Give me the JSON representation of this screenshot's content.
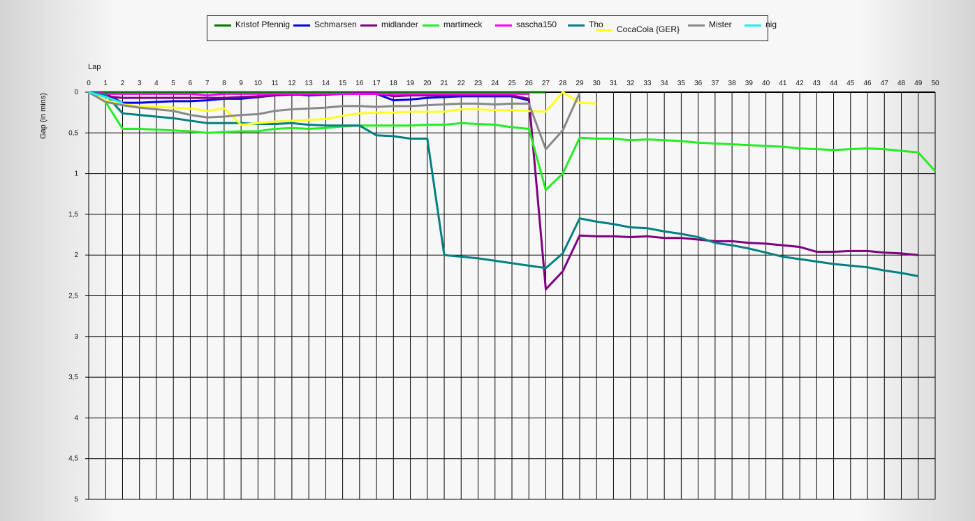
{
  "chart_data": {
    "type": "line",
    "title": "",
    "xlabel": "Lap",
    "ylabel": "Gap (in mins)",
    "xlim": [
      0,
      50
    ],
    "ylim": [
      0,
      5
    ],
    "y_inverted": true,
    "grid": true,
    "legend_position": "top",
    "x_ticks": [
      "0",
      "1",
      "2",
      "3",
      "4",
      "5",
      "6",
      "7",
      "8",
      "9",
      "10",
      "11",
      "12",
      "13",
      "14",
      "15",
      "16",
      "17",
      "18",
      "19",
      "20",
      "21",
      "22",
      "23",
      "24",
      "25",
      "26",
      "27",
      "28",
      "29",
      "30",
      "31",
      "32",
      "33",
      "34",
      "35",
      "36",
      "37",
      "38",
      "39",
      "40",
      "41",
      "42",
      "43",
      "44",
      "45",
      "46",
      "47",
      "48",
      "49",
      "50"
    ],
    "y_ticks": [
      "0",
      "0,5",
      "1",
      "1,5",
      "2",
      "2,5",
      "3",
      "3,5",
      "4",
      "4,5",
      "5"
    ],
    "series": [
      {
        "name": "Kristof Pfennig",
        "color": "#007a00",
        "x": [
          0,
          1,
          2,
          3,
          4,
          5,
          6,
          7,
          8,
          9,
          10,
          11,
          12,
          13,
          14,
          15,
          16,
          17,
          18,
          19,
          20,
          21,
          22,
          23,
          24,
          25,
          26,
          27
        ],
        "y": [
          0,
          0,
          0,
          0,
          0,
          0,
          0,
          0,
          0,
          0,
          0,
          0,
          0,
          0,
          0,
          0,
          0,
          0,
          0,
          0,
          0,
          0,
          0,
          0,
          0,
          0,
          0,
          0
        ]
      },
      {
        "name": "Schmarsen",
        "color": "#0000ee",
        "x": [
          0,
          1,
          2,
          3,
          4,
          5,
          6,
          7,
          8,
          9,
          10,
          11,
          12,
          13,
          14,
          15,
          16,
          17,
          18,
          19,
          20,
          21,
          22,
          23,
          24,
          25,
          26
        ],
        "y": [
          0,
          0.02,
          0.13,
          0.13,
          0.12,
          0.11,
          0.11,
          0.1,
          0.08,
          0.08,
          0.06,
          0.04,
          0.02,
          0.04,
          0.03,
          0.02,
          0.02,
          0.02,
          0.1,
          0.09,
          0.07,
          0.06,
          0.05,
          0.05,
          0.05,
          0.05,
          0.1
        ]
      },
      {
        "name": "midlander",
        "color": "#800080",
        "x": [
          0,
          1,
          2,
          3,
          4,
          5,
          6,
          7,
          8,
          9,
          10,
          11,
          12,
          13,
          14,
          15,
          16,
          17,
          18,
          19,
          20,
          21,
          22,
          23,
          24,
          25,
          26,
          27,
          28,
          29,
          30,
          31,
          32,
          33,
          34,
          35,
          36,
          37,
          38,
          39,
          40,
          41,
          42,
          43,
          44,
          45,
          46,
          47,
          48,
          49
        ],
        "y": [
          0,
          0.05,
          0.07,
          0.07,
          0.07,
          0.07,
          0.07,
          0.07,
          0.07,
          0.06,
          0.05,
          0.04,
          0.03,
          0.03,
          0.03,
          0.02,
          0.01,
          0.01,
          0.05,
          0.04,
          0.04,
          0.04,
          0.04,
          0.04,
          0.04,
          0.04,
          0.08,
          2.42,
          2.2,
          1.76,
          1.77,
          1.77,
          1.78,
          1.77,
          1.79,
          1.79,
          1.81,
          1.83,
          1.83,
          1.85,
          1.86,
          1.88,
          1.9,
          1.96,
          1.96,
          1.95,
          1.95,
          1.97,
          1.98,
          2.0
        ]
      },
      {
        "name": "martimeck",
        "color": "#22ee22",
        "x": [
          0,
          1,
          2,
          3,
          4,
          5,
          6,
          7,
          8,
          9,
          10,
          11,
          12,
          13,
          14,
          15,
          16,
          17,
          18,
          19,
          20,
          21,
          22,
          23,
          24,
          25,
          26,
          27,
          28,
          29,
          30,
          31,
          32,
          33,
          34,
          35,
          36,
          37,
          38,
          39,
          40,
          41,
          42,
          43,
          44,
          45,
          46,
          47,
          48,
          49,
          50
        ],
        "y": [
          0,
          0.12,
          0.45,
          0.45,
          0.46,
          0.47,
          0.48,
          0.5,
          0.49,
          0.48,
          0.48,
          0.45,
          0.44,
          0.45,
          0.44,
          0.42,
          0.41,
          0.41,
          0.41,
          0.41,
          0.4,
          0.4,
          0.38,
          0.39,
          0.4,
          0.43,
          0.45,
          1.2,
          1.0,
          0.56,
          0.57,
          0.57,
          0.59,
          0.58,
          0.59,
          0.6,
          0.62,
          0.63,
          0.64,
          0.65,
          0.66,
          0.67,
          0.69,
          0.7,
          0.71,
          0.7,
          0.69,
          0.7,
          0.72,
          0.74,
          0.97
        ]
      },
      {
        "name": "sascha150",
        "color": "#ff00ff",
        "x": [
          0,
          1,
          2,
          3,
          4,
          5,
          6,
          7,
          8,
          9,
          10,
          11,
          12,
          13,
          14,
          15,
          16,
          17,
          18,
          19,
          20,
          21,
          22,
          23,
          24,
          25,
          26
        ],
        "y": [
          0,
          0.02,
          0.02,
          0.02,
          0.02,
          0.02,
          0.02,
          0.04,
          0.02,
          0.02,
          0.02,
          0.02,
          0.02,
          0.02,
          0.02,
          0.02,
          0.02,
          0.02,
          0.02,
          0.02,
          0.02,
          0.02,
          0.02,
          0.02,
          0.02,
          0.02,
          0.02
        ]
      },
      {
        "name": "Tho",
        "color": "#008080",
        "x": [
          0,
          1,
          2,
          3,
          4,
          5,
          6,
          7,
          8,
          9,
          10,
          11,
          12,
          13,
          14,
          15,
          16,
          17,
          18,
          19,
          20,
          21,
          22,
          23,
          24,
          25,
          26,
          27,
          28,
          29,
          30,
          31,
          32,
          33,
          34,
          35,
          36,
          37,
          38,
          39,
          40,
          41,
          42,
          43,
          44,
          45,
          46,
          47,
          48,
          49
        ],
        "y": [
          0,
          0.03,
          0.26,
          0.28,
          0.3,
          0.32,
          0.35,
          0.38,
          0.38,
          0.38,
          0.39,
          0.39,
          0.38,
          0.4,
          0.41,
          0.41,
          0.41,
          0.53,
          0.54,
          0.57,
          0.57,
          2.0,
          2.02,
          2.04,
          2.07,
          2.1,
          2.13,
          2.16,
          1.98,
          1.55,
          1.59,
          1.62,
          1.66,
          1.67,
          1.71,
          1.74,
          1.78,
          1.85,
          1.88,
          1.92,
          1.97,
          2.02,
          2.05,
          2.08,
          2.11,
          2.13,
          2.15,
          2.19,
          2.22,
          2.26
        ]
      },
      {
        "name": "CocaCola {GER}",
        "color": "#ffff22",
        "x": [
          0,
          1,
          2,
          3,
          4,
          5,
          6,
          7,
          8,
          9,
          10,
          11,
          12,
          13,
          14,
          15,
          16,
          17,
          18,
          19,
          20,
          21,
          22,
          23,
          24,
          25,
          26,
          27,
          28,
          29,
          30
        ],
        "y": [
          0,
          0.1,
          0.15,
          0.17,
          0.18,
          0.19,
          0.2,
          0.23,
          0.2,
          0.4,
          0.38,
          0.36,
          0.35,
          0.34,
          0.33,
          0.29,
          0.26,
          0.25,
          0.25,
          0.24,
          0.24,
          0.24,
          0.21,
          0.21,
          0.22,
          0.22,
          0.23,
          0.24,
          0.0,
          0.13,
          0.14
        ]
      },
      {
        "name": "Mister",
        "color": "#888888",
        "x": [
          0,
          1,
          2,
          3,
          4,
          5,
          6,
          7,
          8,
          9,
          10,
          11,
          12,
          13,
          14,
          15,
          16,
          17,
          18,
          19,
          20,
          21,
          22,
          23,
          24,
          25,
          26,
          27,
          28,
          29
        ],
        "y": [
          0,
          0.12,
          0.16,
          0.19,
          0.21,
          0.23,
          0.28,
          0.31,
          0.3,
          0.28,
          0.27,
          0.23,
          0.21,
          0.2,
          0.19,
          0.17,
          0.17,
          0.18,
          0.17,
          0.17,
          0.16,
          0.15,
          0.14,
          0.14,
          0.15,
          0.14,
          0.14,
          0.7,
          0.47,
          0.01
        ]
      },
      {
        "name": "nig",
        "color": "#22eeee",
        "x": [
          0,
          1,
          2
        ],
        "y": [
          0,
          0.06,
          0.13
        ]
      }
    ]
  }
}
